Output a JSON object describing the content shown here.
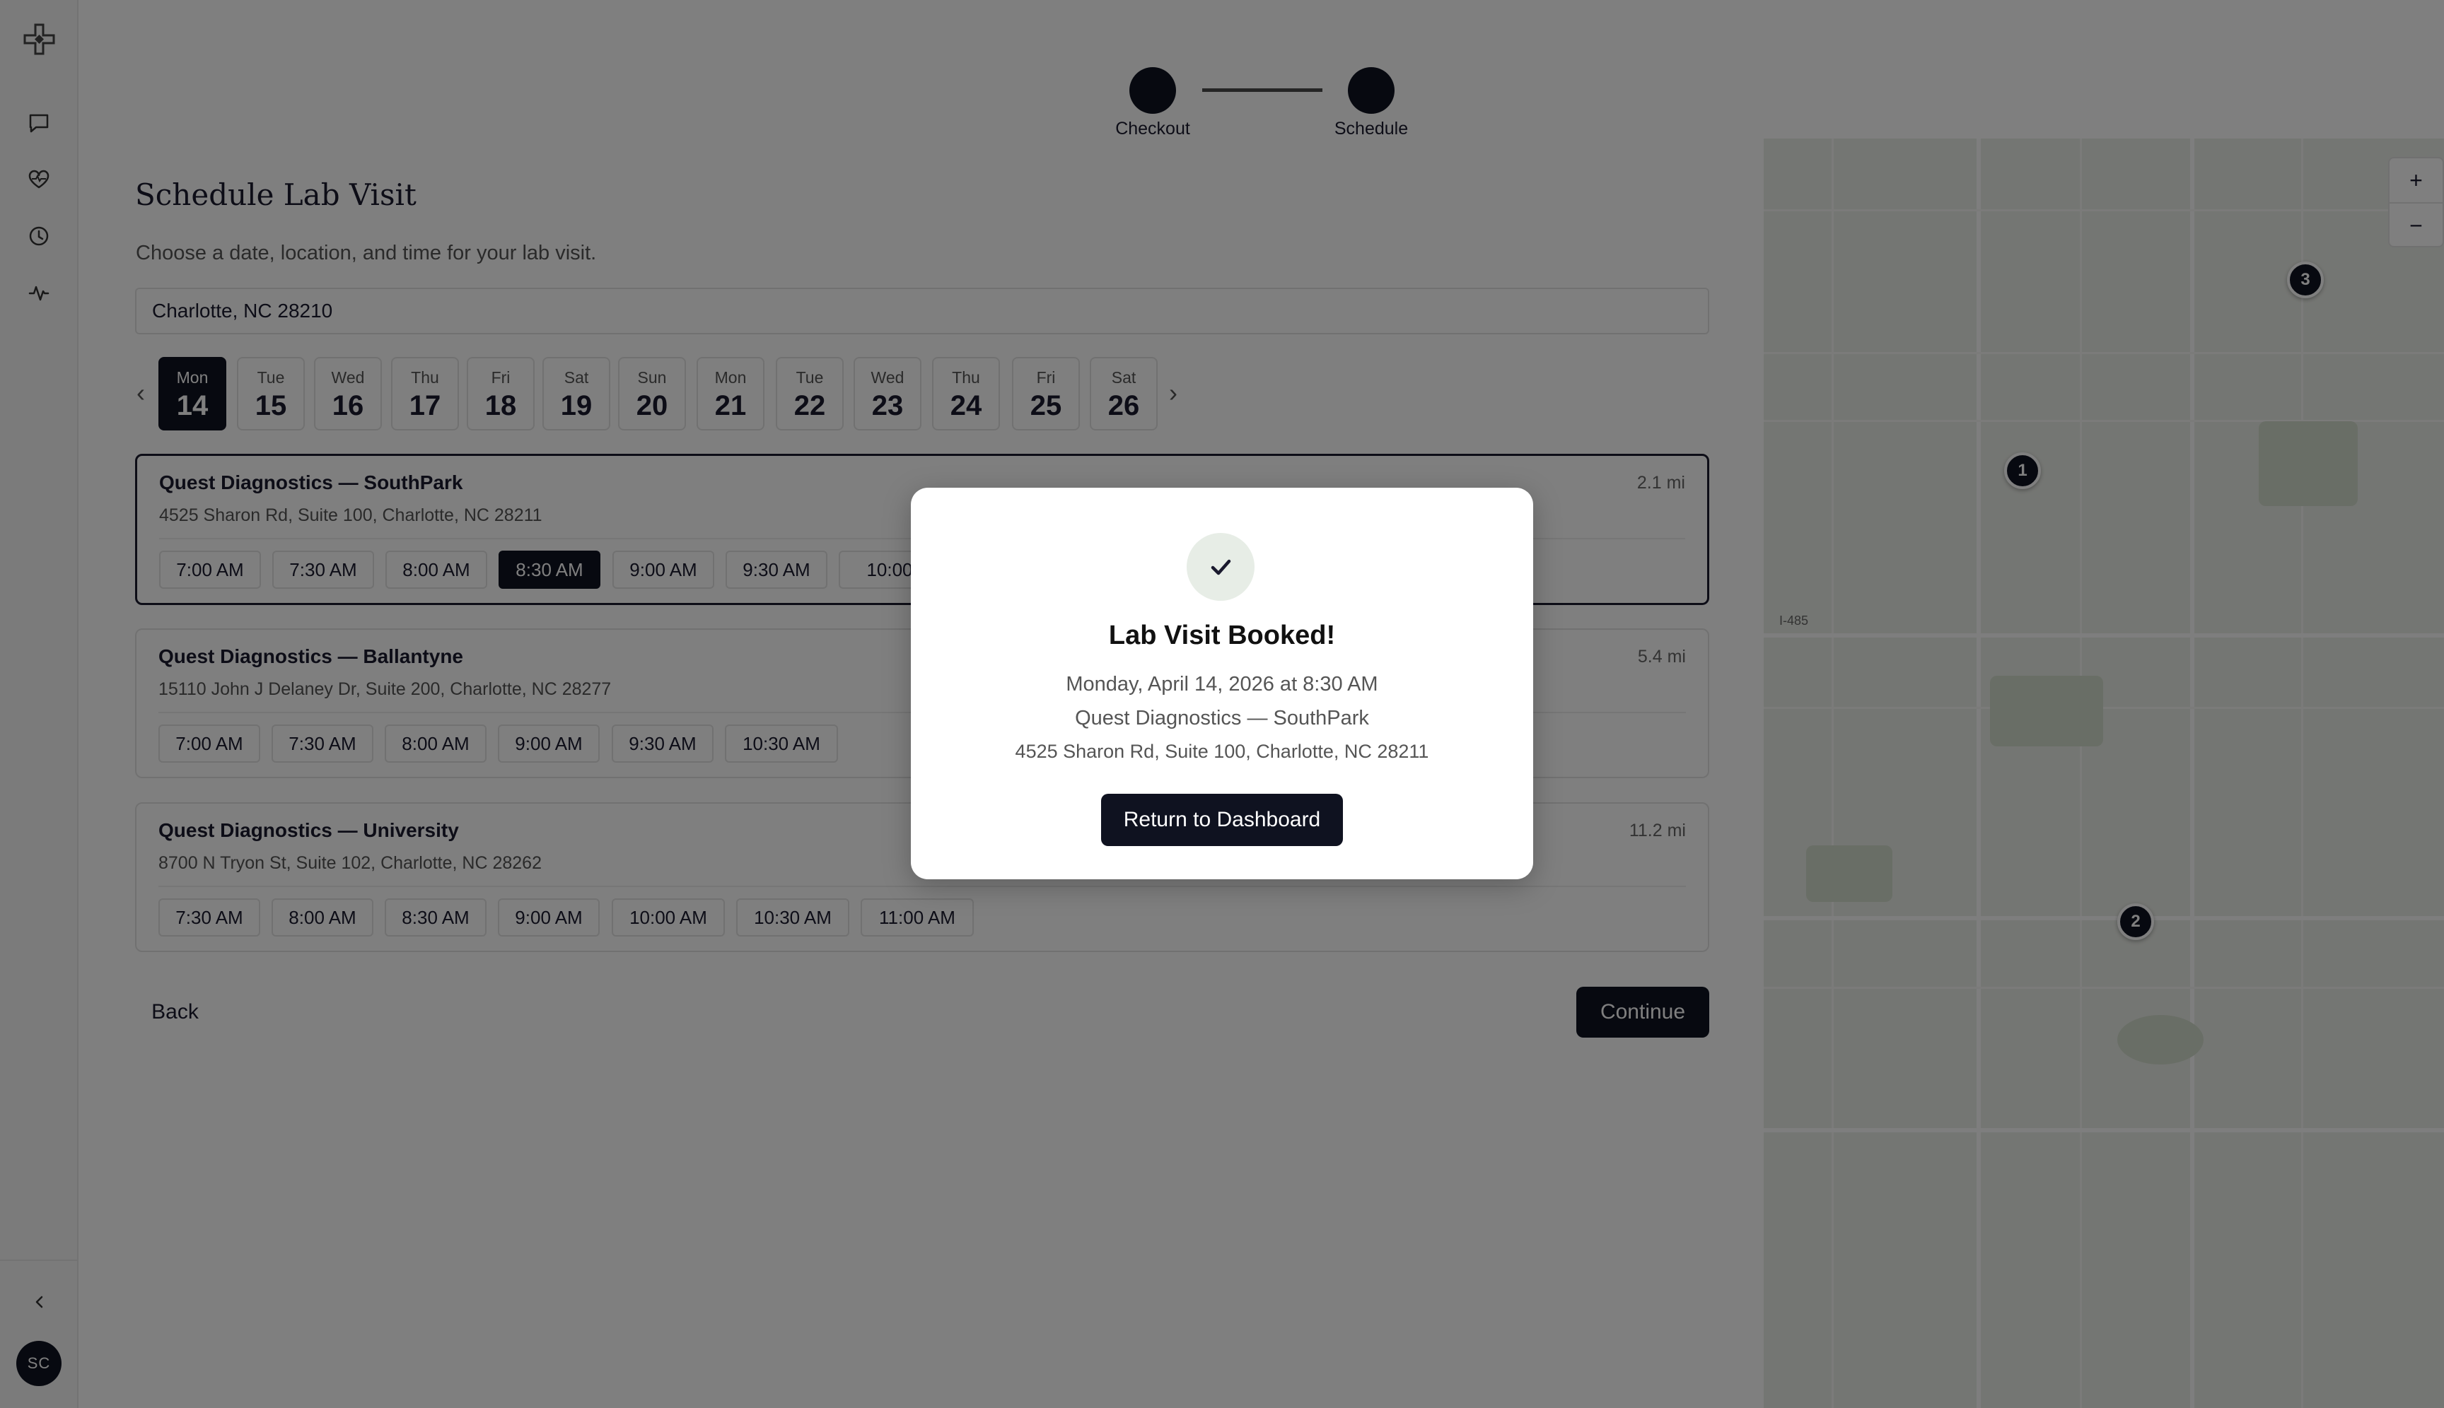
{
  "sidebar": {
    "logo_icon": "medical-cross-logo",
    "items": [
      {
        "icon": "chat-icon"
      },
      {
        "icon": "heart-pulse-icon"
      },
      {
        "icon": "clock-icon"
      },
      {
        "icon": "activity-icon"
      }
    ],
    "collapse_icon": "chevron-left-icon",
    "avatar_initials": "SC"
  },
  "stepper": {
    "steps": [
      {
        "label": "Checkout"
      },
      {
        "label": "Schedule"
      }
    ]
  },
  "main": {
    "title": "Schedule Lab Visit",
    "subtitle": "Choose a date, location, and time for your lab visit.",
    "location_value": "Charlotte, NC 28210",
    "prev_arrow": "‹",
    "next_arrow": "›",
    "dates": [
      {
        "dow": "Mon",
        "day": "14",
        "selected": true
      },
      {
        "dow": "Tue",
        "day": "15"
      },
      {
        "dow": "Wed",
        "day": "16"
      },
      {
        "dow": "Thu",
        "day": "17"
      },
      {
        "dow": "Fri",
        "day": "18"
      },
      {
        "dow": "Sat",
        "day": "19"
      },
      {
        "dow": "Sun",
        "day": "20"
      },
      {
        "dow": "Mon",
        "day": "21"
      },
      {
        "dow": "Tue",
        "day": "22"
      },
      {
        "dow": "Wed",
        "day": "23"
      },
      {
        "dow": "Thu",
        "day": "24"
      },
      {
        "dow": "Fri",
        "day": "25"
      },
      {
        "dow": "Sat",
        "day": "26"
      }
    ],
    "labs": [
      {
        "name": "Quest Diagnostics — SouthPark",
        "address": "4525 Sharon Rd, Suite 100, Charlotte, NC 28211",
        "distance": "2.1 mi",
        "selected": true,
        "slots": [
          "7:00 AM",
          "7:30 AM",
          "8:00 AM",
          "8:30 AM",
          "9:00 AM",
          "9:30 AM",
          "10:00"
        ],
        "selected_slot": "8:30 AM"
      },
      {
        "name": "Quest Diagnostics — Ballantyne",
        "address": "15110 John J Delaney Dr, Suite 200, Charlotte, NC 28277",
        "distance": "5.4 mi",
        "slots": [
          "7:00 AM",
          "7:30 AM",
          "8:00 AM",
          "9:00 AM",
          "9:30 AM",
          "10:30 AM"
        ]
      },
      {
        "name": "Quest Diagnostics — University",
        "address": "8700 N Tryon St, Suite 102, Charlotte, NC 28262",
        "distance": "11.2 mi",
        "slots": [
          "7:30 AM",
          "8:00 AM",
          "8:30 AM",
          "9:00 AM",
          "10:00 AM",
          "10:30 AM",
          "11:00 AM"
        ]
      }
    ],
    "back_label": "Back",
    "continue_label": "Continue"
  },
  "map": {
    "road_label": "I-485",
    "pins": [
      "1",
      "2",
      "3"
    ],
    "zoom_in": "+",
    "zoom_out": "−"
  },
  "modal": {
    "icon": "check-icon",
    "title": "Lab Visit Booked!",
    "datetime": "Monday, April 14, 2026 at 8:30 AM",
    "lab_name": "Quest Diagnostics — SouthPark",
    "address": "4525 Sharon Rd, Suite 100, Charlotte, NC 28211",
    "button_label": "Return to Dashboard"
  }
}
